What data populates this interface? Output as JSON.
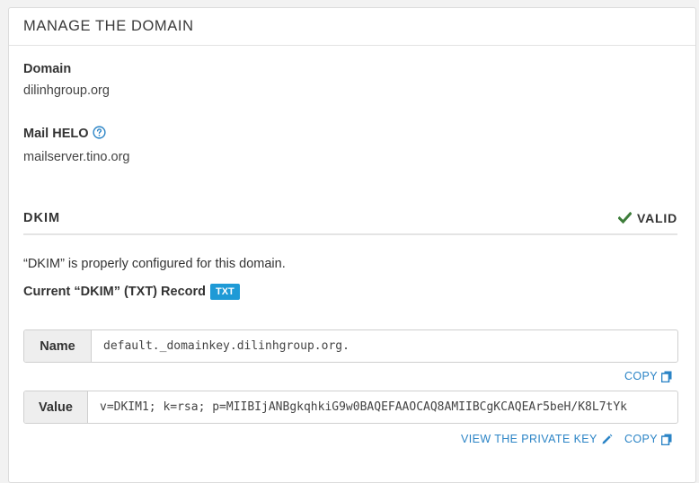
{
  "panel": {
    "title": "MANAGE THE DOMAIN"
  },
  "domain": {
    "label": "Domain",
    "value": "dilinhgroup.org"
  },
  "mail_helo": {
    "label": "Mail HELO",
    "value": "mailserver.tino.org",
    "icon": "question-circle-icon"
  },
  "dkim": {
    "title": "DKIM",
    "status": "VALID",
    "status_icon": "checkmark-icon",
    "status_color": "#3d7d3a",
    "description": "“DKIM” is properly configured for this domain.",
    "record_label": "Current “DKIM” (TXT) Record",
    "record_badge": "TXT",
    "badge_color": "#1e9ad6",
    "name_label": "Name",
    "name_value": "default._domainkey.dilinhgroup.org.",
    "value_label": "Value",
    "value_value": "v=DKIM1; k=rsa; p=MIIBIjANBgkqhkiG9w0BAQEFAAOCAQ8AMIIBCgKCAQEAr5beH/K8L7tYk",
    "copy_label": "COPY",
    "view_private_key_label": "VIEW THE PRIVATE KEY",
    "link_color": "#2b84c6"
  }
}
